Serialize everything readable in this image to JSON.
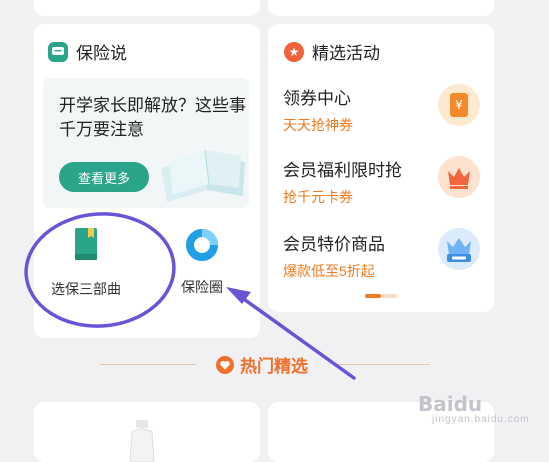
{
  "insurance_talk": {
    "title": "保险说",
    "article_title": "开学家长即解放？这些事千万要注意",
    "more_label": "查看更多",
    "tools": [
      {
        "label": "选保三部曲",
        "icon": "green-book-icon"
      },
      {
        "label": "保险圈",
        "icon": "blue-ring-icon"
      }
    ]
  },
  "activities": {
    "title": "精选活动",
    "items": [
      {
        "title": "领券中心",
        "subtitle": "天天抢神券",
        "icon": "coupon-icon"
      },
      {
        "title": "会员福利限时抢",
        "subtitle": "抢千元卡券",
        "icon": "crown-icon"
      },
      {
        "title": "会员特价商品",
        "subtitle": "爆款低至5折起",
        "icon": "special-offer-crown-icon"
      }
    ],
    "carousel_page": 1,
    "carousel_pages": 2
  },
  "hot": {
    "title": "热门精选"
  },
  "watermark": {
    "logo": "Baidu",
    "sub": "jingyan.baidu.com"
  },
  "colors": {
    "green": "#2aa58a",
    "orange": "#ef7a1f",
    "annotation": "#6b53d8",
    "background": "#f1f1f3"
  }
}
